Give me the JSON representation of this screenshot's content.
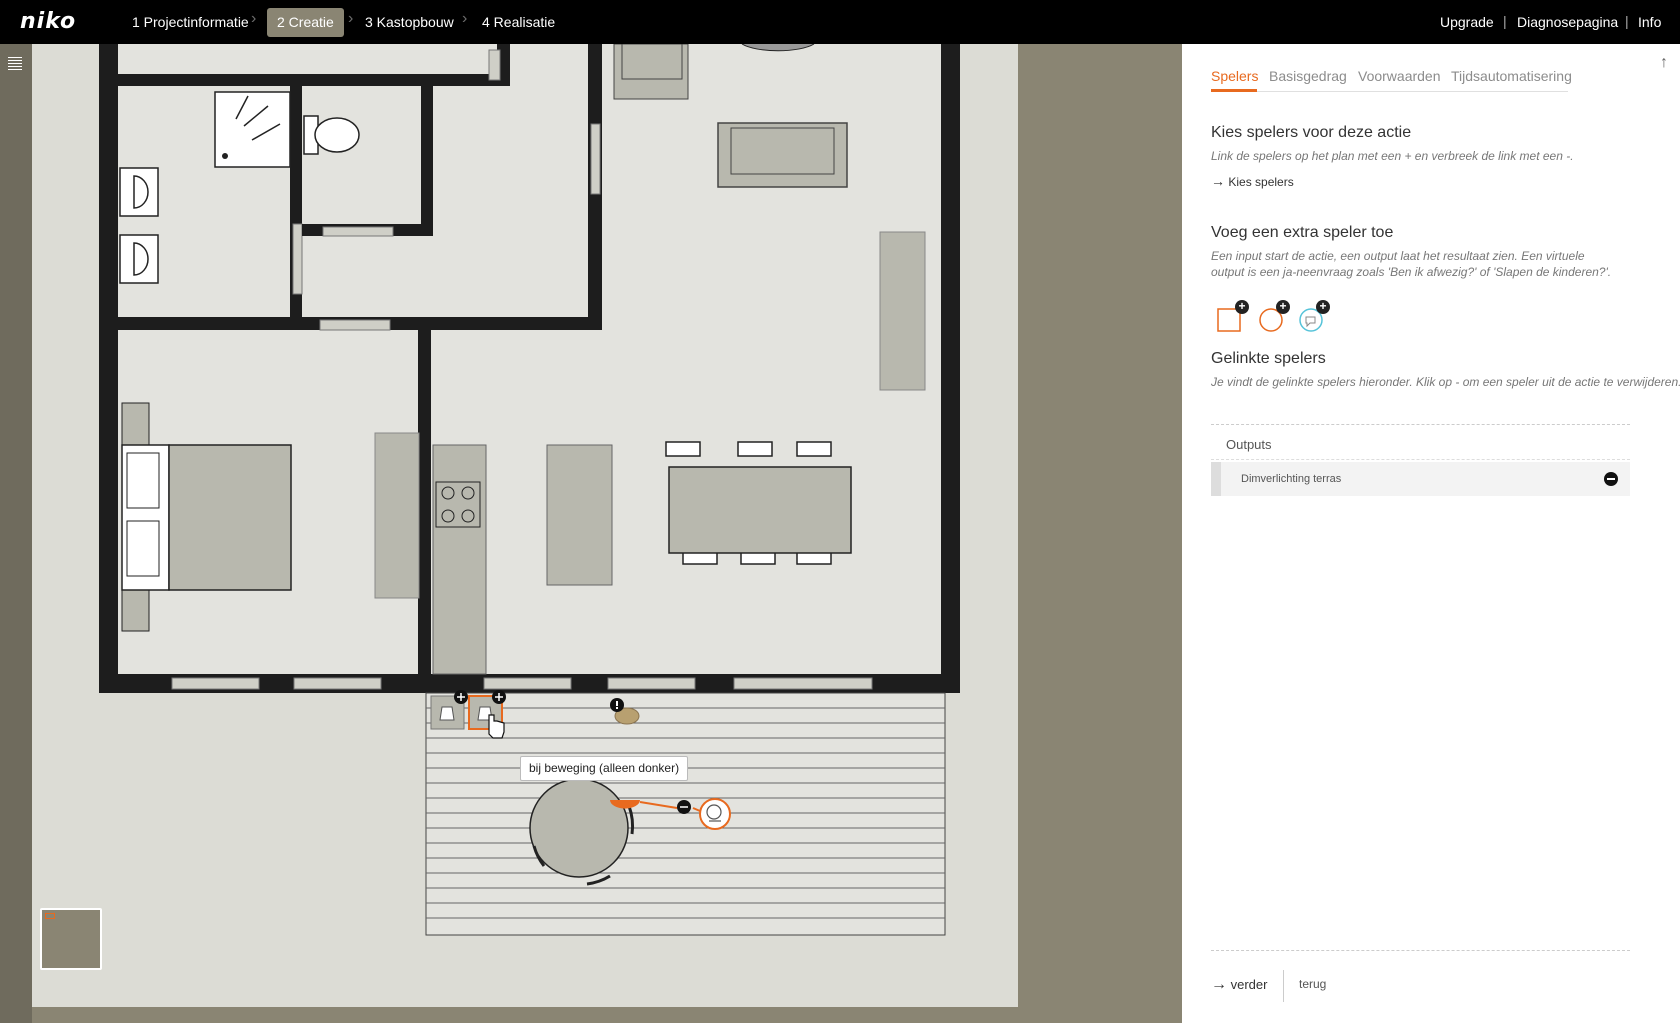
{
  "header": {
    "logo": "niko",
    "steps": [
      {
        "label": "1 Projectinformatie"
      },
      {
        "label": "2 Creatie"
      },
      {
        "label": "3 Kastopbouw"
      },
      {
        "label": "4 Realisatie"
      }
    ],
    "active_step": 1,
    "links": {
      "upgrade": "Upgrade",
      "diagnose": "Diagnosepagina",
      "info": "Info"
    }
  },
  "canvas": {
    "tooltip": "bij beweging (alleen donker)"
  },
  "panel": {
    "tabs": [
      "Spelers",
      "Basisgedrag",
      "Voorwaarden",
      "Tijdsautomatisering"
    ],
    "active_tab": 0,
    "choose": {
      "title": "Kies spelers voor deze actie",
      "desc": "Link de spelers op het plan met een + en verbreek de link met een -.",
      "link": "Kies spelers"
    },
    "extra": {
      "title": "Voeg een extra speler toe",
      "desc": "Een input start de actie, een output laat het resultaat zien. Een virtuele output is een ja-neenvraag zoals 'Ben ik afwezig?' of 'Slapen de kinderen?'."
    },
    "linked": {
      "title": "Gelinkte spelers",
      "desc": "Je vindt de gelinkte spelers hieronder. Klik op - om een speler uit de actie te verwijderen.",
      "outputs_label": "Outputs",
      "players": [
        {
          "name": "Dimverlichting terras"
        }
      ]
    },
    "footer": {
      "next": "verder",
      "back": "terug"
    }
  },
  "colors": {
    "accent": "#e86a1f",
    "topbar": "#000000",
    "canvas_bg": "#dcdcd5",
    "workspace": "#8a8573"
  }
}
